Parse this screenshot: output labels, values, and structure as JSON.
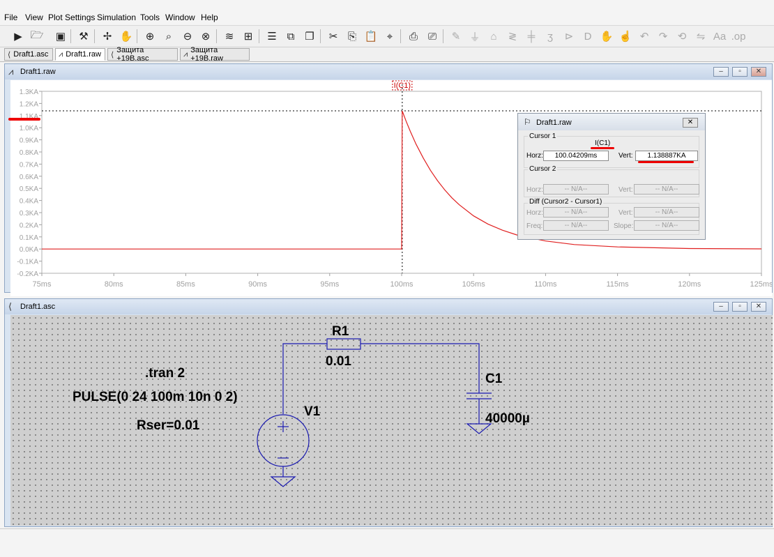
{
  "menu": [
    "File",
    "View",
    "Plot Settings",
    "Simulation",
    "Tools",
    "Window",
    "Help"
  ],
  "toolbar_icons": [
    "run-icon",
    "open-icon",
    "save-icon",
    "control-panel-icon",
    "halt-icon",
    "pan-icon",
    "zoom-in-icon",
    "zoom-full-icon",
    "zoom-out-icon",
    "zoom-cancel-icon",
    "autorange-icon",
    "plot-icon",
    "tile-horizontal-icon",
    "tile-vertical-icon",
    "cascade-icon",
    "cut-icon",
    "copy-icon",
    "paste-icon",
    "find-icon",
    "print-icon",
    "print-setup-icon",
    "wire-icon",
    "ground-icon",
    "label-icon",
    "resistor-icon",
    "capacitor-icon",
    "inductor-icon",
    "diode-icon",
    "component-icon",
    "move-icon",
    "drag-icon",
    "undo-icon",
    "redo-icon",
    "rotate-icon",
    "mirror-icon",
    "text-icon",
    "spice-directive-icon"
  ],
  "tabs": [
    {
      "label": "Draft1.asc",
      "icon": "schematic-icon",
      "active": false
    },
    {
      "label": "Draft1.raw",
      "icon": "waveform-icon",
      "active": true
    },
    {
      "label": "Защита +19В.asc",
      "icon": "schematic-icon",
      "active": false
    },
    {
      "label": "Защита +19В.raw",
      "icon": "waveform-icon",
      "active": false
    }
  ],
  "plot_window": {
    "title": "Draft1.raw",
    "trace_label": "I(C1)",
    "trace_color": "#e02020",
    "cursor_level": "1.138887KA"
  },
  "chart_data": {
    "type": "line",
    "title": "",
    "xlabel": "",
    "ylabel": "",
    "xlim": [
      75,
      125
    ],
    "ylim": [
      -0.2,
      1.3
    ],
    "x_ticks": [
      "75ms",
      "80ms",
      "85ms",
      "90ms",
      "95ms",
      "100ms",
      "105ms",
      "110ms",
      "115ms",
      "120ms",
      "125ms"
    ],
    "y_ticks": [
      "1.3KA",
      "1.2KA",
      "1.1KA",
      "1.0KA",
      "0.9KA",
      "0.8KA",
      "0.7KA",
      "0.6KA",
      "0.5KA",
      "0.4KA",
      "0.3KA",
      "0.2KA",
      "0.1KA",
      "0.0KA",
      "-0.1KA",
      "-0.2KA"
    ],
    "grid": false,
    "series": [
      {
        "name": "I(C1)",
        "x": [
          75,
          99.99,
          100.0,
          100.04,
          100.3,
          100.6,
          101,
          101.5,
          102,
          102.5,
          103,
          103.5,
          104,
          105,
          106,
          107,
          108,
          110,
          112,
          115,
          120,
          125
        ],
        "y": [
          0,
          0,
          0,
          1.139,
          1.057,
          0.97,
          0.865,
          0.75,
          0.649,
          0.562,
          0.487,
          0.421,
          0.365,
          0.273,
          0.206,
          0.155,
          0.116,
          0.066,
          0.037,
          0.017,
          0.004,
          0.001
        ]
      }
    ],
    "cursor": {
      "x": 100.04209,
      "y": 1.138887
    }
  },
  "cursor_panel": {
    "title": "Draft1.raw",
    "cursor1_label": "Cursor 1",
    "trace": "I(C1)",
    "horz_label": "Horz:",
    "horz_value": "100.04209ms",
    "vert_label": "Vert:",
    "vert_value": "1.138887KA",
    "cursor2_label": "Cursor 2",
    "c2_horz": "-- N/A--",
    "c2_vert": "-- N/A--",
    "diff_label": "Diff (Cursor2 - Cursor1)",
    "freq_label": "Freq:",
    "slope_label": "Slope:",
    "d_horz": "-- N/A--",
    "d_vert": "-- N/A--",
    "d_freq": "-- N/A--",
    "d_slope": "-- N/A--"
  },
  "schematic_window": {
    "title": "Draft1.asc",
    "tran": ".tran 2",
    "pulse": "PULSE(0 24 100m 10n 0 2)",
    "rser": "Rser=0.01",
    "r1_name": "R1",
    "r1_value": "0.01",
    "c1_name": "C1",
    "c1_value": "40000µ",
    "v1_name": "V1",
    "wire_color": "#1a1ab0"
  }
}
